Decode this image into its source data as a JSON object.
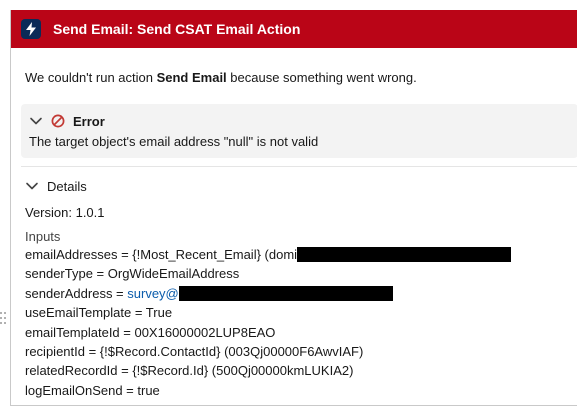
{
  "header": {
    "title": "Send Email: Send CSAT Email Action",
    "icon": "lightning-bolt-icon",
    "background": "#ba0517"
  },
  "summary": {
    "prefix": "We couldn't run action ",
    "action": "Send Email",
    "suffix": " because something went wrong."
  },
  "error": {
    "title": "Error",
    "message": "The target object's email address \"null\" is not valid",
    "icon": "error-ban-icon"
  },
  "details": {
    "title": "Details",
    "version": "Version: 1.0.1",
    "inputs_label": "Inputs",
    "lines": {
      "email_addresses": "emailAddresses = {!Most_Recent_Email} (domi",
      "sender_type": "senderType = OrgWideEmailAddress",
      "sender_address_prefix": "senderAddress = ",
      "sender_address_link": "survey@",
      "use_email_template": "useEmailTemplate = True",
      "email_template_id": "emailTemplateId = 00X16000002LUP8EAO",
      "recipient_id": "recipientId = {!$Record.ContactId} (003Qj00000F6AwvIAF)",
      "related_record_id": "relatedRecordId = {!$Record.Id} (500Qj00000kmLUKIA2)",
      "log_email_on_send": "logEmailOnSend = true"
    }
  }
}
